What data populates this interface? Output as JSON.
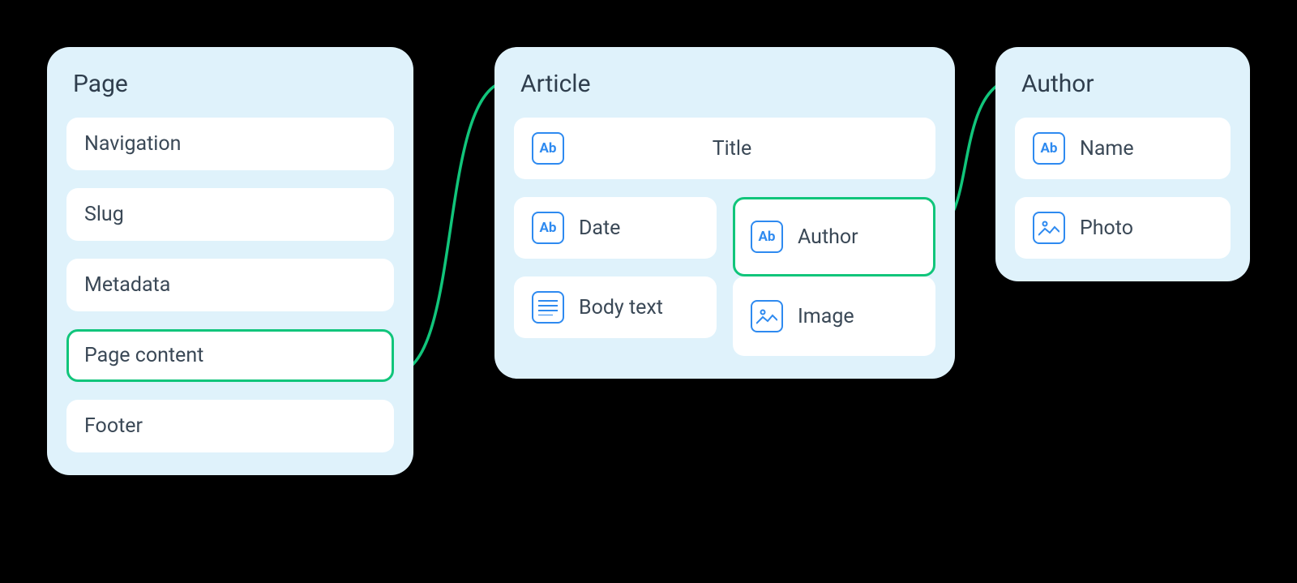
{
  "page_card": {
    "title": "Page",
    "fields": {
      "navigation": "Navigation",
      "slug": "Slug",
      "metadata": "Metadata",
      "page_content": "Page content",
      "footer": "Footer"
    }
  },
  "article_card": {
    "title": "Article",
    "fields": {
      "title": "Title",
      "date": "Date",
      "author": "Author",
      "body_text": "Body text",
      "image": "Image"
    }
  },
  "author_card": {
    "title": "Author",
    "fields": {
      "name": "Name",
      "photo": "Photo"
    }
  },
  "colors": {
    "card_bg": "#dff2fb",
    "field_bg": "#ffffff",
    "text": "#3a4856",
    "accent_blue": "#2e8af0",
    "accent_green": "#11c57b",
    "canvas_bg": "#000000"
  }
}
